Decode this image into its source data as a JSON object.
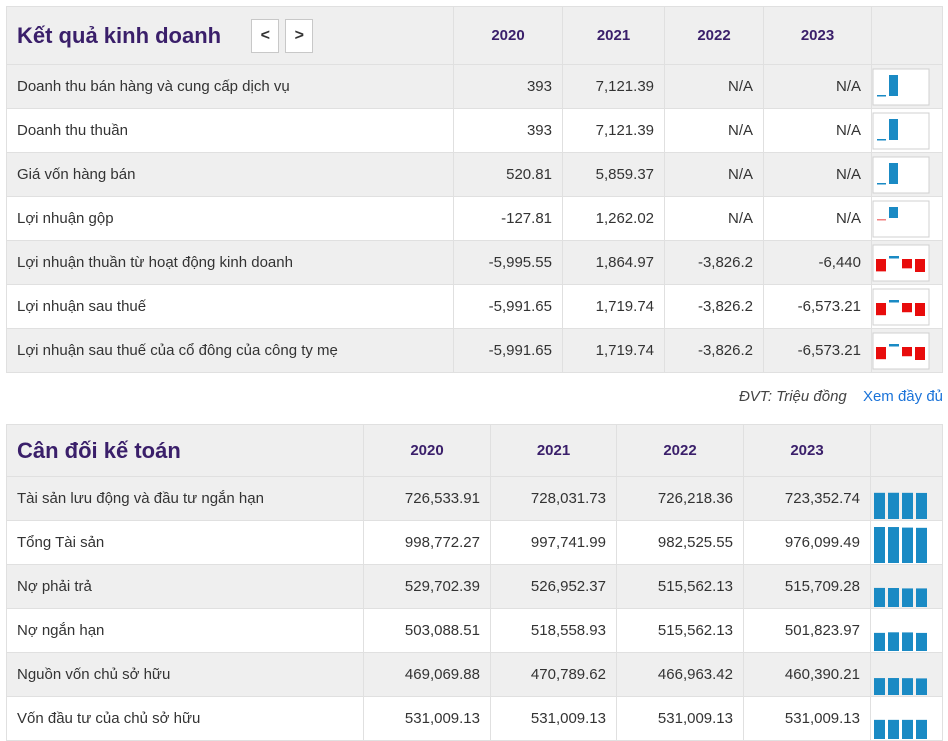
{
  "results": {
    "title": "Kết quả kinh doanh",
    "prev_label": "<",
    "next_label": ">",
    "years": [
      "2020",
      "2021",
      "2022",
      "2023"
    ],
    "rows": [
      {
        "label": "Doanh thu bán hàng và cung cấp dịch vụ",
        "values": [
          "393",
          "7,121.39",
          "N/A",
          "N/A"
        ],
        "nums": [
          393,
          7121.39,
          null,
          null
        ]
      },
      {
        "label": "Doanh thu thuần",
        "values": [
          "393",
          "7,121.39",
          "N/A",
          "N/A"
        ],
        "nums": [
          393,
          7121.39,
          null,
          null
        ]
      },
      {
        "label": "Giá vốn hàng bán",
        "values": [
          "520.81",
          "5,859.37",
          "N/A",
          "N/A"
        ],
        "nums": [
          520.81,
          5859.37,
          null,
          null
        ]
      },
      {
        "label": "Lợi nhuận gộp",
        "values": [
          "-127.81",
          "1,262.02",
          "N/A",
          "N/A"
        ],
        "nums": [
          -127.81,
          1262.02,
          null,
          null
        ]
      },
      {
        "label": "Lợi nhuận thuần từ hoạt động kinh doanh",
        "values": [
          "-5,995.55",
          "1,864.97",
          "-3,826.2",
          "-6,440"
        ],
        "nums": [
          -5995.55,
          1864.97,
          -3826.2,
          -6440
        ]
      },
      {
        "label": "Lợi nhuận sau thuế",
        "values": [
          "-5,991.65",
          "1,719.74",
          "-3,826.2",
          "-6,573.21"
        ],
        "nums": [
          -5991.65,
          1719.74,
          -3826.2,
          -6573.21
        ]
      },
      {
        "label": "Lợi nhuận sau thuế của cổ đông của công ty mẹ",
        "values": [
          "-5,991.65",
          "1,719.74",
          "-3,826.2",
          "-6,573.21"
        ],
        "nums": [
          -5991.65,
          1719.74,
          -3826.2,
          -6573.21
        ]
      }
    ]
  },
  "unit_label": "ĐVT: Triệu đồng",
  "view_all_label": "Xem đầy đủ",
  "balance": {
    "title": "Cân đối kế toán",
    "years": [
      "2020",
      "2021",
      "2022",
      "2023"
    ],
    "rows": [
      {
        "label": "Tài sản lưu động và đầu tư ngắn hạn",
        "values": [
          "726,533.91",
          "728,031.73",
          "726,218.36",
          "723,352.74"
        ],
        "nums": [
          726533.91,
          728031.73,
          726218.36,
          723352.74
        ]
      },
      {
        "label": "Tổng Tài sản",
        "values": [
          "998,772.27",
          "997,741.99",
          "982,525.55",
          "976,099.49"
        ],
        "nums": [
          998772.27,
          997741.99,
          982525.55,
          976099.49
        ]
      },
      {
        "label": "Nợ phải trả",
        "values": [
          "529,702.39",
          "526,952.37",
          "515,562.13",
          "515,709.28"
        ],
        "nums": [
          529702.39,
          526952.37,
          515562.13,
          515709.28
        ]
      },
      {
        "label": "Nợ ngắn hạn",
        "values": [
          "503,088.51",
          "518,558.93",
          "515,562.13",
          "501,823.97"
        ],
        "nums": [
          503088.51,
          518558.93,
          515562.13,
          501823.97
        ]
      },
      {
        "label": "Nguồn vốn chủ sở hữu",
        "values": [
          "469,069.88",
          "470,789.62",
          "466,963.42",
          "460,390.21"
        ],
        "nums": [
          469069.88,
          470789.62,
          466963.42,
          460390.21
        ]
      },
      {
        "label": "Vốn đầu tư của chủ sở hữu",
        "values": [
          "531,009.13",
          "531,009.13",
          "531,009.13",
          "531,009.13"
        ],
        "nums": [
          531009.13,
          531009.13,
          531009.13,
          531009.13
        ]
      }
    ]
  },
  "colors": {
    "positive": "#1a8ac4",
    "negative": "#e80c0c",
    "negative_small": "#f08080",
    "title": "#3a1f6a",
    "link": "#1a73d9"
  }
}
